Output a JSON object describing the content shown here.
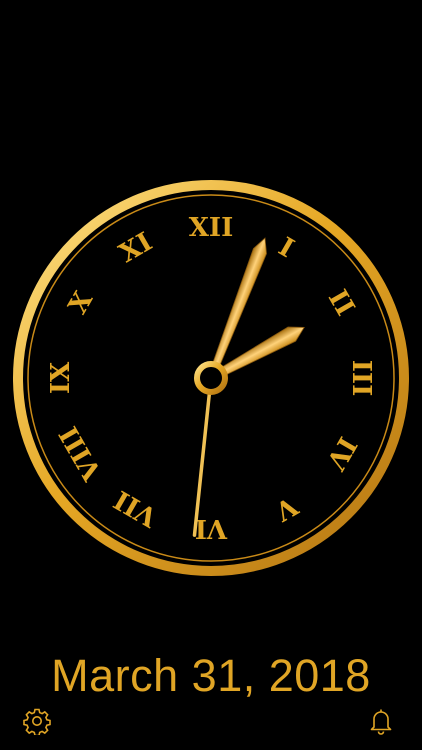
{
  "theme": {
    "background": "#000000",
    "gold": "#e0a525",
    "gold_light": "#ffd97a",
    "gold_dark": "#8a5a10",
    "face": "#000000"
  },
  "clock": {
    "numerals": [
      "XII",
      "I",
      "II",
      "III",
      "IV",
      "V",
      "VI",
      "VII",
      "VIII",
      "IX",
      "X",
      "XI"
    ],
    "time": {
      "hours": 2,
      "minutes": 3,
      "seconds": 31
    }
  },
  "date": {
    "text": "March 31, 2018"
  },
  "toolbar": {
    "settings_icon": "gear-icon",
    "alarm_icon": "bell-icon"
  }
}
